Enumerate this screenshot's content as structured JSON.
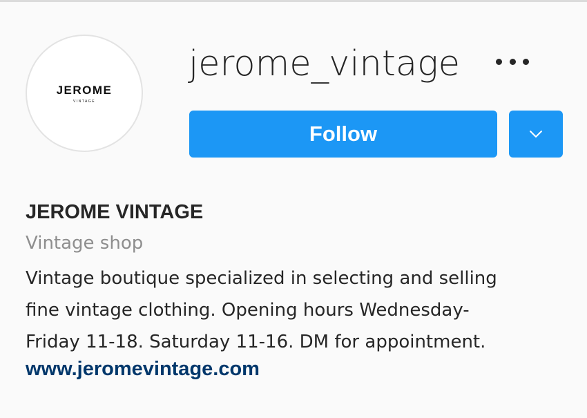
{
  "profile": {
    "avatar": {
      "brand": "JEROME",
      "sub": "VINTAGE"
    },
    "username": "jerome_vintage",
    "follow_label": "Follow",
    "more_icon": "ellipsis-icon",
    "dropdown_icon": "chevron-down-icon",
    "full_name": "JEROME VINTAGE",
    "category": "Vintage shop",
    "bio_lines": [
      "Vintage boutique specialized in selecting and selling",
      "fine vintage clothing. Opening hours Wednesday-",
      "Friday 11-18. Saturday 11-16. DM for appointment."
    ],
    "website": "www.jeromevintage.com"
  },
  "colors": {
    "background": "#fafafa",
    "accent_blue": "#1c97f5",
    "text_primary": "#262626",
    "text_secondary": "#8e8e8e",
    "link": "#00376b"
  }
}
